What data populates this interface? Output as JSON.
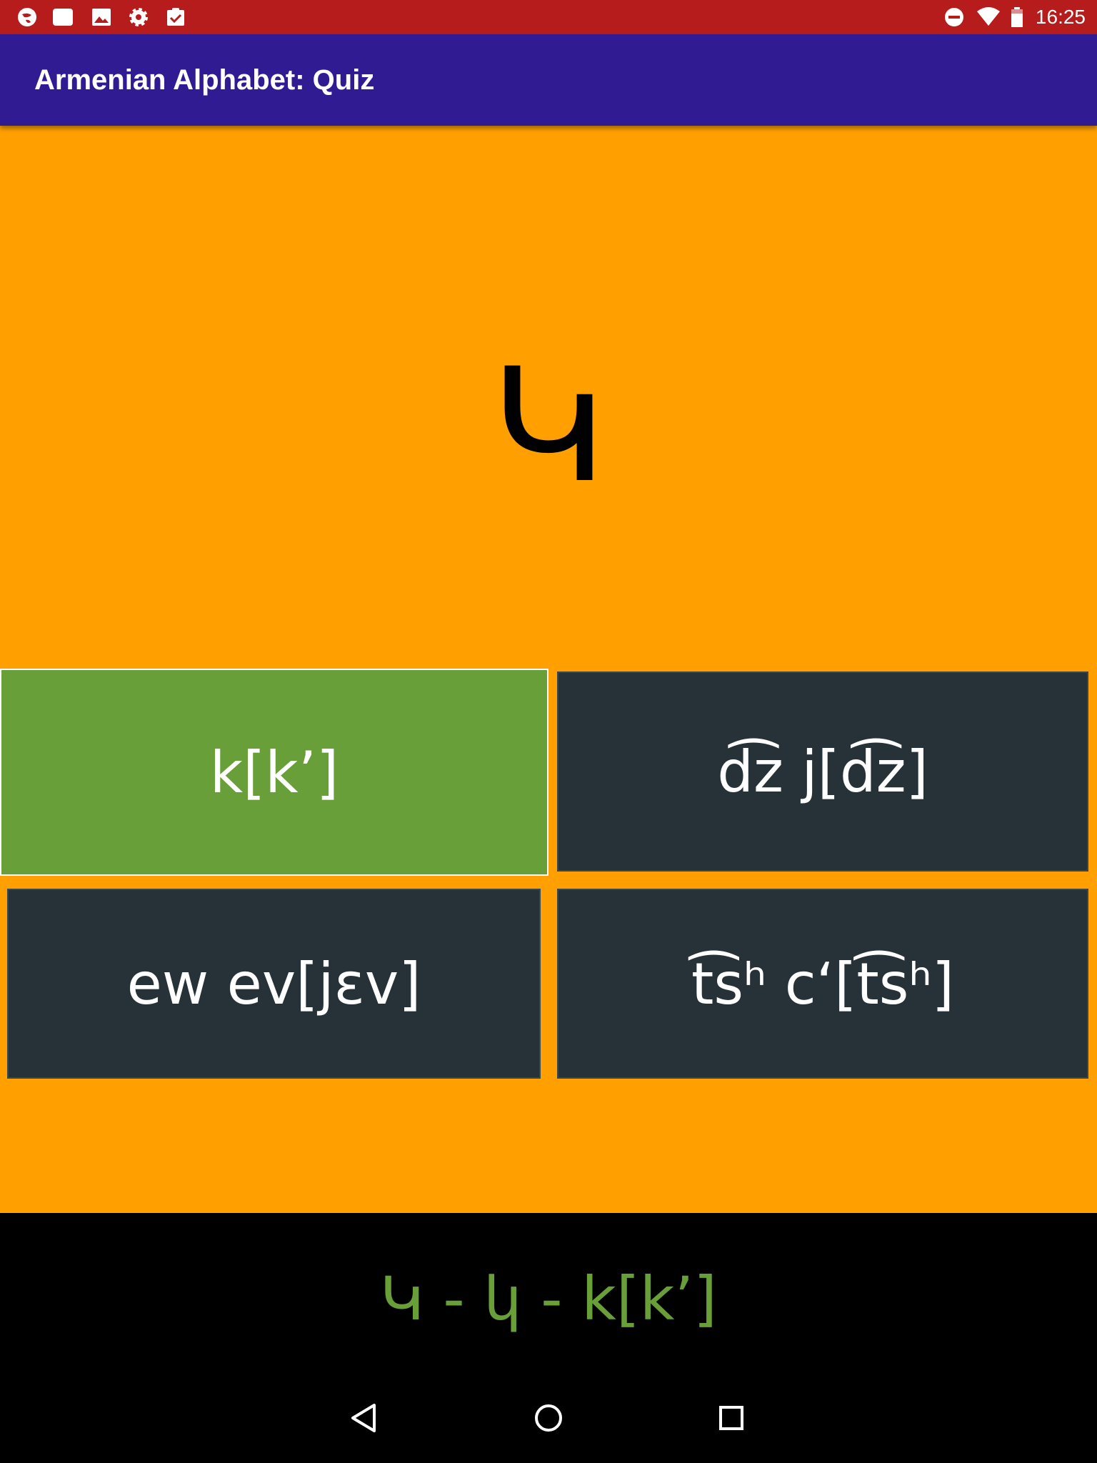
{
  "status_bar": {
    "time": "16:25",
    "left_icons": [
      "globe-icon",
      "notes-icon",
      "image-icon",
      "settings-icon",
      "clipboard-check-icon"
    ],
    "right_icons": [
      "do-not-disturb-icon",
      "wifi-icon",
      "battery-icon"
    ],
    "background": "#b71c1c"
  },
  "app_bar": {
    "title": "Armenian Alphabet: Quiz",
    "background": "#311b92"
  },
  "quiz": {
    "letter": "Կ",
    "background": "#ffa000",
    "answers": [
      {
        "label": "k[kʼ]",
        "state": "correct"
      },
      {
        "label": "d͡z j[d͡z]",
        "state": "default"
      },
      {
        "label": "ew ev[jɛv]",
        "state": "default"
      },
      {
        "label": "t͡sʰ cʻ[t͡sʰ]",
        "state": "default"
      }
    ],
    "correct_color": "#689f38",
    "default_color": "#263238"
  },
  "feedback": {
    "text": "Կ - կ - k[kʼ]",
    "color": "#689f38"
  },
  "nav_bar": {
    "buttons": [
      "back-icon",
      "home-icon",
      "recents-icon"
    ]
  }
}
